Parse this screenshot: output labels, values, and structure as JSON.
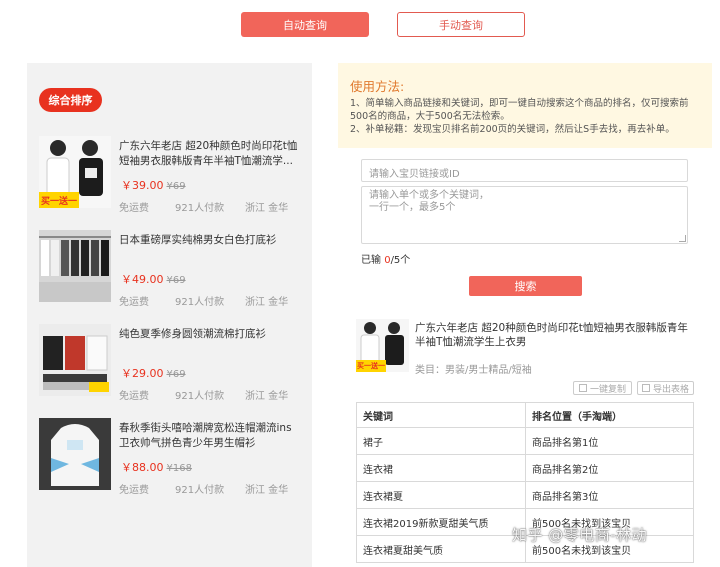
{
  "tabs": {
    "auto": "自动查询",
    "manual": "手动查询"
  },
  "left": {
    "sort_label": "综合排序",
    "products": [
      {
        "title": "广东六年老店 超20种颜色时尚印花t恤短袖男衣服韩版青年半袖T恤潮流学...",
        "price": "￥39.00",
        "old_price": "¥69",
        "shipping": "免运费",
        "sold": "921人付款",
        "location": "浙江 金华",
        "badge": "买一送一"
      },
      {
        "title": "日本重磅厚实纯棉男女白色打底衫",
        "price": "￥49.00",
        "old_price": "¥69",
        "shipping": "免运费",
        "sold": "921人付款",
        "location": "浙江 金华"
      },
      {
        "title": "纯色夏季修身圆领潮流棉打底衫",
        "price": "￥29.00",
        "old_price": "¥69",
        "shipping": "免运费",
        "sold": "921人付款",
        "location": "浙江 金华"
      },
      {
        "title": "春秋季街头嘻哈潮牌宽松连帽潮流ins卫衣帅气拼色青少年男生帽衫",
        "price": "￥88.00",
        "old_price": "¥168",
        "shipping": "免运费",
        "sold": "921人付款",
        "location": "浙江 金华"
      }
    ]
  },
  "howto": {
    "heading": "使用方法:",
    "line1": "1、简单输入商品链接和关键词，即可一键自动搜索这个商品的排名，仅可搜索前",
    "line2": "500名的商品，大于500名无法检索。",
    "line3": "2、补单秘籍：发现宝贝排名前200页的关键词，然后让S手去找，再去补单。"
  },
  "form": {
    "url_placeholder": "请输入宝贝链接或ID",
    "kw_line1": "请输入单个或多个关键词，",
    "kw_line2": "一行一个，最多5个",
    "count_prefix": "已输 ",
    "count_value": "0",
    "count_suffix": "/5个",
    "search_label": "搜索"
  },
  "result": {
    "title": "广东六年老店 超20种颜色时尚印花t恤短袖男衣服韩版青年半袖T恤潮流学生上衣男",
    "category": "类目：男装/男士精品/短袖",
    "badge": "买一送一",
    "copy_label": "一键复制",
    "export_label": "导出表格",
    "table": {
      "headers": [
        "关键词",
        "排名位置（手淘端）"
      ],
      "rows": [
        [
          "裙子",
          "商品排名第1位"
        ],
        [
          "连衣裙",
          "商品排名第2位"
        ],
        [
          "连衣裙夏",
          "商品排名第3位"
        ],
        [
          "连衣裙2019新款夏甜美气质",
          "前500名未找到该宝贝"
        ],
        [
          "连衣裙夏甜美气质",
          "前500名未找到该宝贝"
        ]
      ]
    }
  },
  "watermark": "知乎 @零电商-林动",
  "colors": {
    "accent": "#f1655a",
    "price": "#e8321f",
    "howto_bg": "#fff8e2",
    "howto_heading": "#e0792e"
  }
}
